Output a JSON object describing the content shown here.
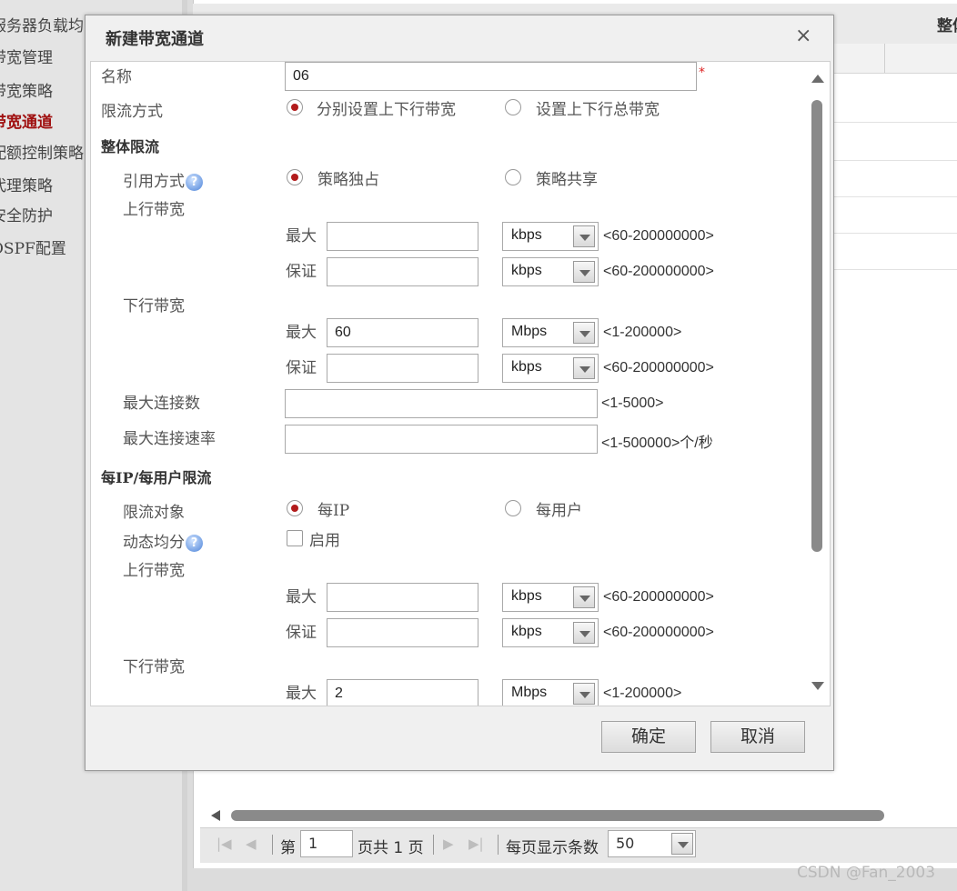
{
  "background": {
    "nav_items": [
      "服务器负载均",
      "带宽管理",
      "带宽策略",
      "带宽通道",
      "配额控制策略",
      "代理策略",
      "安全防护",
      "OSPF配置"
    ],
    "header_text": "整体",
    "pager": {
      "page_prefix": "第",
      "page_value": "1",
      "page_suffix": "页共 1 页",
      "per_page_label": "每页显示条数",
      "per_page_value": "50"
    },
    "watermark": "CSDN @Fan_2003"
  },
  "dialog": {
    "title": "新建带宽通道",
    "close_symbol": "×",
    "name": {
      "label": "名称",
      "value": "06",
      "required_mark": "*"
    },
    "limit_mode": {
      "label": "限流方式",
      "options": [
        "分别设置上下行带宽",
        "设置上下行总带宽"
      ],
      "selected": 0
    },
    "overall": {
      "section_title": "整体限流",
      "ref_mode": {
        "label": "引用方式",
        "options": [
          "策略独占",
          "策略共享"
        ],
        "selected": 0
      },
      "upstream": {
        "label": "上行带宽",
        "max": {
          "label": "最大",
          "value": "",
          "unit": "kbps",
          "range": "<60-200000000>"
        },
        "guarantee": {
          "label": "保证",
          "value": "",
          "unit": "kbps",
          "range": "<60-200000000>"
        }
      },
      "downstream": {
        "label": "下行带宽",
        "max": {
          "label": "最大",
          "value": "60",
          "unit": "Mbps",
          "range": "<1-200000>"
        },
        "guarantee": {
          "label": "保证",
          "value": "",
          "unit": "kbps",
          "range": "<60-200000000>"
        }
      },
      "max_conn": {
        "label": "最大连接数",
        "value": "",
        "range": "<1-5000>"
      },
      "max_conn_rate": {
        "label": "最大连接速率",
        "value": "",
        "range": "<1-500000>个/秒"
      }
    },
    "per_ip": {
      "section_title": "每IP/每用户限流",
      "target": {
        "label": "限流对象",
        "options": [
          "每IP",
          "每用户"
        ],
        "selected": 0
      },
      "dynamic_split": {
        "label": "动态均分",
        "checkbox_label": "启用",
        "checked": false
      },
      "upstream": {
        "label": "上行带宽",
        "max": {
          "label": "最大",
          "value": "",
          "unit": "kbps",
          "range": "<60-200000000>"
        },
        "guarantee": {
          "label": "保证",
          "value": "",
          "unit": "kbps",
          "range": "<60-200000000>"
        }
      },
      "downstream": {
        "label": "下行带宽",
        "max": {
          "label": "最大",
          "value": "2",
          "unit": "Mbps",
          "range": "<1-200000>"
        }
      }
    },
    "help_symbol": "?",
    "buttons": {
      "ok": "确定",
      "cancel": "取消"
    }
  },
  "colors": {
    "accent_red": "#b21b1b",
    "active_nav": "#a01111"
  }
}
